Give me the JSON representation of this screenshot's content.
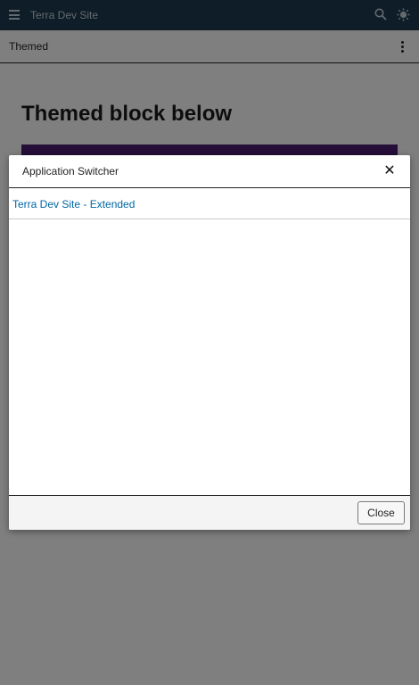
{
  "topbar": {
    "site_title": "Terra Dev Site",
    "icons": [
      "menu-icon",
      "search-icon",
      "theme-icon"
    ]
  },
  "subbar": {
    "title": "Themed",
    "icons": [
      "kebab-icon"
    ]
  },
  "content": {
    "heading": "Themed block below",
    "themed_block_color": "#4b1c6e"
  },
  "dialog": {
    "title": "Application Switcher",
    "items": [
      {
        "label": "Terra Dev Site - Extended"
      }
    ],
    "close_label": "Close",
    "close_icon": "close-icon"
  },
  "colors": {
    "topbar_bg": "#1d3a4f",
    "link": "#0065a3",
    "overlay": "rgba(0,0,0,0.5)"
  }
}
